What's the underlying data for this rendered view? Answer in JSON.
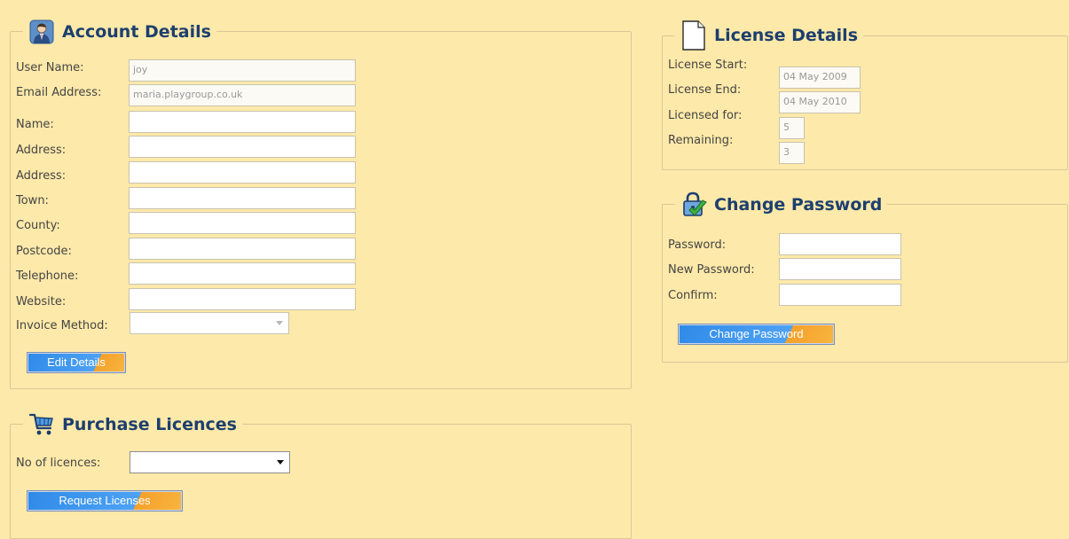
{
  "account": {
    "title": "Account Details",
    "fields": [
      {
        "label": "User Name:",
        "value": "joy"
      },
      {
        "label": "Email Address:",
        "value": "maria.playgroup.co.uk"
      },
      {
        "label": "Name:",
        "value": ""
      },
      {
        "label": "Address:",
        "value": ""
      },
      {
        "label": "Address:",
        "value": ""
      },
      {
        "label": "Town:",
        "value": ""
      },
      {
        "label": "County:",
        "value": ""
      },
      {
        "label": "Postcode:",
        "value": ""
      },
      {
        "label": "Telephone:",
        "value": ""
      },
      {
        "label": "Website:",
        "value": ""
      }
    ],
    "invoice_label": "Invoice Method:",
    "invoice_value": "",
    "edit_button": "Edit Details"
  },
  "purchase": {
    "title": "Purchase Licences",
    "licences_label": "No of licences:",
    "licences_value": "",
    "request_button": "Request Licenses"
  },
  "license": {
    "title": "License Details",
    "fields": [
      {
        "label": "License Start:",
        "value": "04 May 2009"
      },
      {
        "label": "License End:",
        "value": "04 May 2010"
      },
      {
        "label": "Licensed for:",
        "value": "5"
      },
      {
        "label": "Remaining:",
        "value": "3"
      }
    ]
  },
  "password": {
    "title": "Change Password",
    "fields": [
      {
        "label": "Password:",
        "value": ""
      },
      {
        "label": "New Password:",
        "value": ""
      },
      {
        "label": "Confirm:",
        "value": ""
      }
    ],
    "change_button": "Change Password"
  },
  "colors": {
    "background": "#fde9a9",
    "heading": "#1d3f6e",
    "button_blue": "#2f8ae8",
    "button_orange": "#f5a12a"
  },
  "icons": {
    "account": "user-icon",
    "purchase": "cart-icon",
    "license": "document-icon",
    "password": "lock-check-icon"
  }
}
